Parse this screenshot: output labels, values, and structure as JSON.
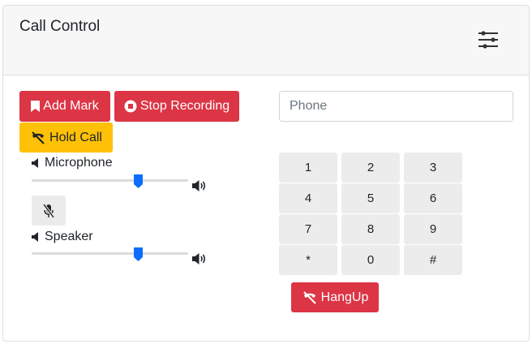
{
  "header": {
    "title": "Call Control"
  },
  "buttons": {
    "add_mark": "Add Mark",
    "stop_recording": "Stop Recording",
    "hold_call": "Hold Call",
    "hangup": "HangUp"
  },
  "audio": {
    "microphone_label": "Microphone",
    "speaker_label": "Speaker",
    "microphone_level": 0.68,
    "speaker_level": 0.68
  },
  "phone": {
    "placeholder": "Phone",
    "value": ""
  },
  "keypad": [
    "1",
    "2",
    "3",
    "4",
    "5",
    "6",
    "7",
    "8",
    "9",
    "*",
    "0",
    "#"
  ],
  "colors": {
    "danger": "#dc3545",
    "warning": "#ffc107",
    "slider_thumb": "#0d6efd"
  },
  "icons": {
    "settings": "sliders-icon",
    "add_mark": "bookmark-icon",
    "stop_recording": "stop-circle-icon",
    "hold_call": "phone-slash-icon",
    "hangup": "phone-slash-icon",
    "volume": "volume-icon",
    "volume_up": "volume-up-icon",
    "mute": "microphone-slash-icon"
  }
}
